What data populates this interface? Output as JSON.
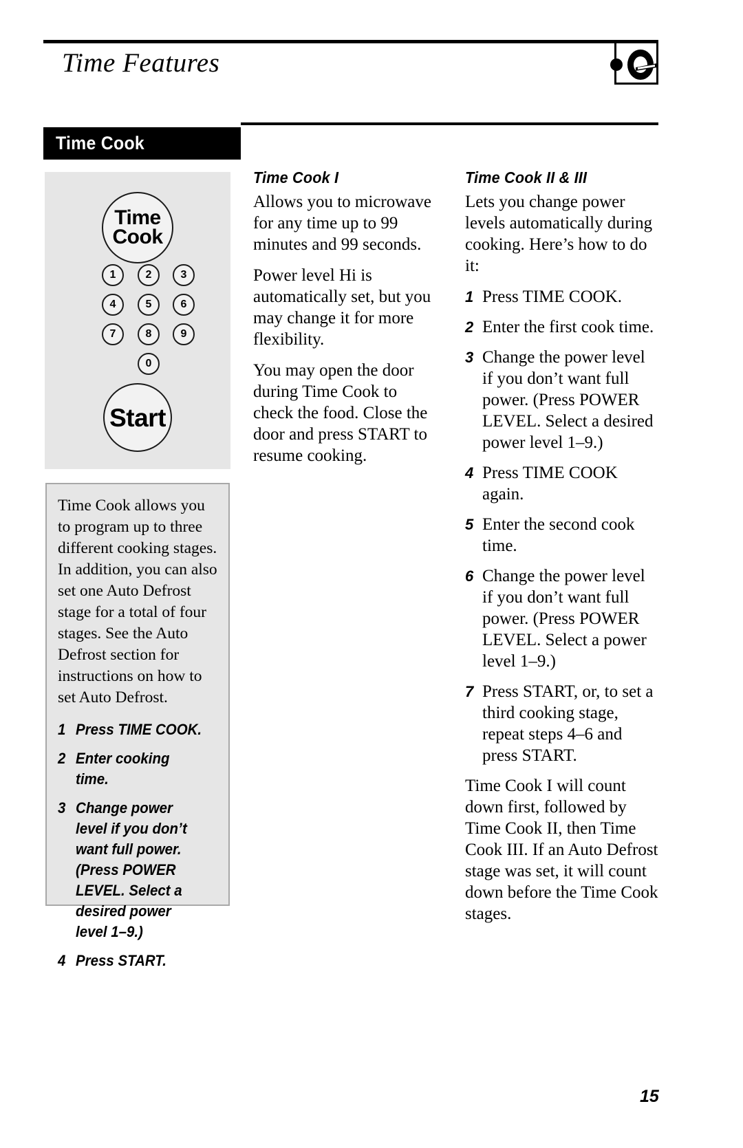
{
  "header": {
    "title": "Time Features",
    "corner_icon": "pan-icon"
  },
  "section": {
    "label": "Time Cook"
  },
  "keypad": {
    "timecook_line1": "Time",
    "timecook_line2": "Cook",
    "keys": [
      "1",
      "2",
      "3",
      "4",
      "5",
      "6",
      "7",
      "8",
      "9",
      "0"
    ],
    "start_label": "Start"
  },
  "callout": {
    "body": "Time Cook allows you to program up to three different cooking stages. In addition, you can also set one Auto Defrost stage for a total of four stages. See the Auto Defrost section for instructions on how to set Auto Defrost.",
    "steps": [
      {
        "num": "1",
        "text": "Press TIME COOK."
      },
      {
        "num": "2",
        "text": "Enter cooking time."
      },
      {
        "num": "3",
        "text": "Change power level if you don’t want full power. (Press POWER LEVEL. Select a desired power level 1–9.)"
      },
      {
        "num": "4",
        "text": "Press START."
      }
    ]
  },
  "middle_column": {
    "heading": "Time Cook I",
    "paragraphs": [
      "Allows you to microwave for any time up to 99 minutes and 99 seconds.",
      "Power level Hi is automatically set, but you may change it for more flexibility.",
      "You may open the door during Time Cook to check the food. Close the door and press START to resume cooking."
    ]
  },
  "right_column": {
    "heading": "Time Cook II & III",
    "intro": "Lets you change power levels automatically during cooking. Here’s how to do it:",
    "steps": [
      {
        "num": "1",
        "text": "Press TIME COOK."
      },
      {
        "num": "2",
        "text": "Enter the first cook time."
      },
      {
        "num": "3",
        "text": "Change the power level if you don’t want full power. (Press POWER LEVEL. Select a desired power level 1–9.)"
      },
      {
        "num": "4",
        "text": "Press TIME COOK again."
      },
      {
        "num": "5",
        "text": "Enter the second cook time."
      },
      {
        "num": "6",
        "text": "Change the power level if you don’t want full power. (Press POWER LEVEL. Select a power level 1–9.)"
      },
      {
        "num": "7",
        "text": "Press START, or, to set a third cooking stage, repeat steps 4–6 and press START."
      }
    ],
    "closing": "Time Cook I will count down first, followed by Time Cook II, then Time Cook III. If an Auto Defrost stage was set, it will count down before the Time Cook stages."
  },
  "footer": {
    "page_number": "15"
  }
}
